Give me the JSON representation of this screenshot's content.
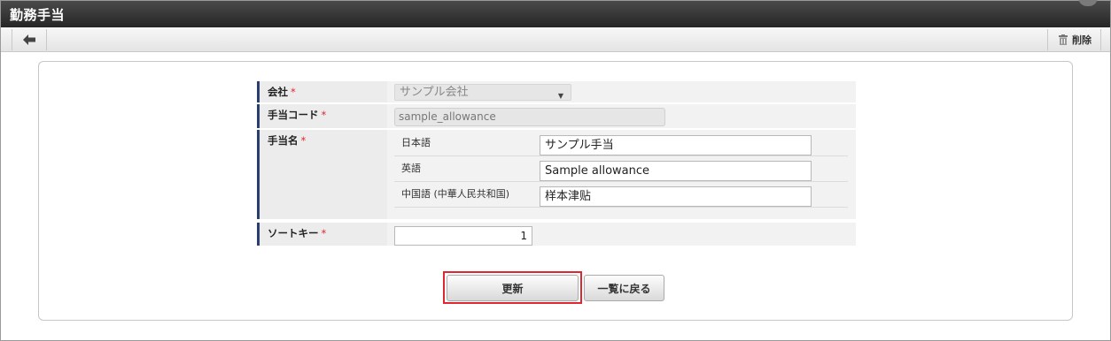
{
  "window": {
    "title": "勤務手当"
  },
  "toolbar": {
    "delete_label": "削除"
  },
  "form": {
    "company": {
      "label": "会社",
      "required_mark": "*",
      "value": "サンプル会社"
    },
    "allowance_code": {
      "label": "手当コード",
      "required_mark": "*",
      "value": "sample_allowance"
    },
    "allowance_name": {
      "label": "手当名",
      "required_mark": "*",
      "locales": [
        {
          "label": "日本語",
          "value": "サンプル手当"
        },
        {
          "label": "英語",
          "value": "Sample allowance"
        },
        {
          "label": "中国語 (中華人民共和国)",
          "value": "样本津贴"
        }
      ]
    },
    "sort_key": {
      "label": "ソートキー",
      "required_mark": "*",
      "value": "1"
    }
  },
  "actions": {
    "update_label": "更新",
    "back_to_list_label": "一覧に戻る"
  },
  "colors": {
    "header_bg": "#2b2b2b",
    "label_accent": "#2b3f6f",
    "required": "#e0262f",
    "highlight": "#e0262f"
  }
}
